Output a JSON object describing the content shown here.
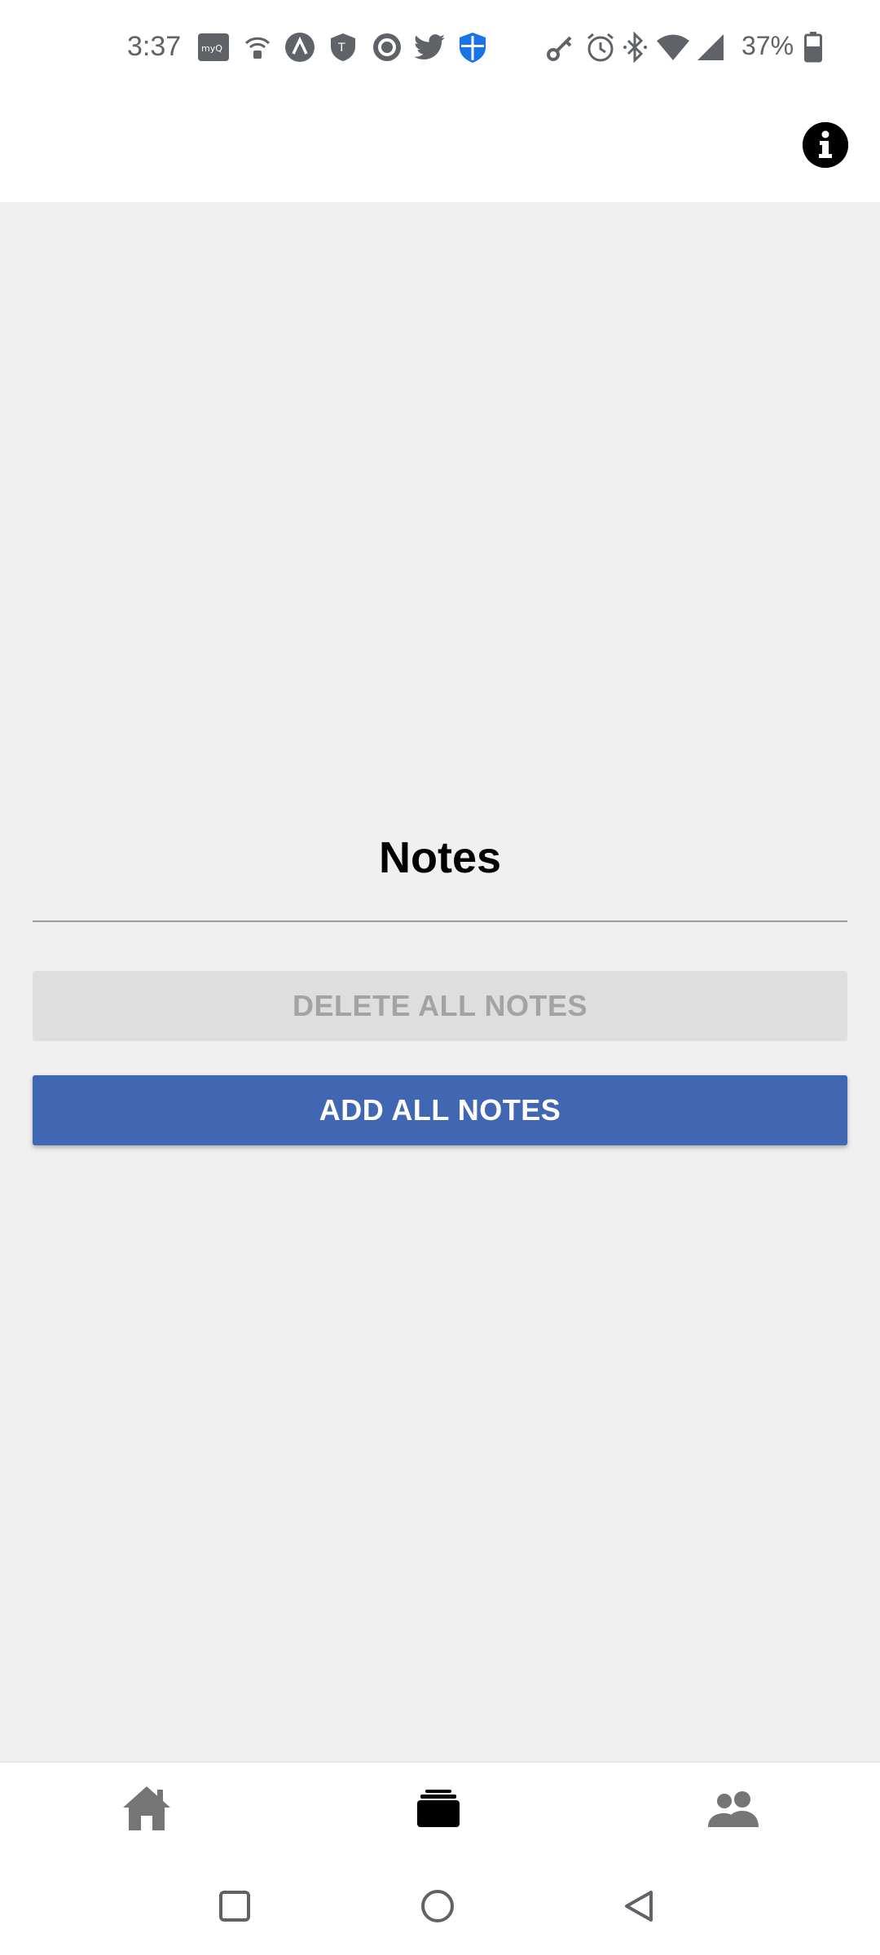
{
  "status_bar": {
    "time": "3:37",
    "battery_percent": "37%",
    "notification_icons": [
      "myq-icon",
      "wifi-calling-icon",
      "arc-icon",
      "tmobile-shield-icon",
      "circle-app-icon",
      "twitter-icon",
      "defender-shield-icon"
    ],
    "system_icons": [
      "vpn-key-icon",
      "alarm-icon",
      "bluetooth-icon",
      "wifi-icon",
      "signal-icon",
      "battery-icon"
    ]
  },
  "app_bar": {
    "info_icon": "info-icon"
  },
  "notes": {
    "title": "Notes",
    "delete_label": "DELETE ALL NOTES",
    "add_label": "ADD ALL NOTES"
  },
  "bottom_nav": {
    "items": [
      {
        "icon": "home-icon",
        "active": false
      },
      {
        "icon": "cards-icon",
        "active": true
      },
      {
        "icon": "people-icon",
        "active": false
      }
    ]
  },
  "colors": {
    "primary": "#4267b2",
    "disabled_bg": "#dedede",
    "disabled_text": "#a3a3a3",
    "background": "#f0f0f0"
  }
}
